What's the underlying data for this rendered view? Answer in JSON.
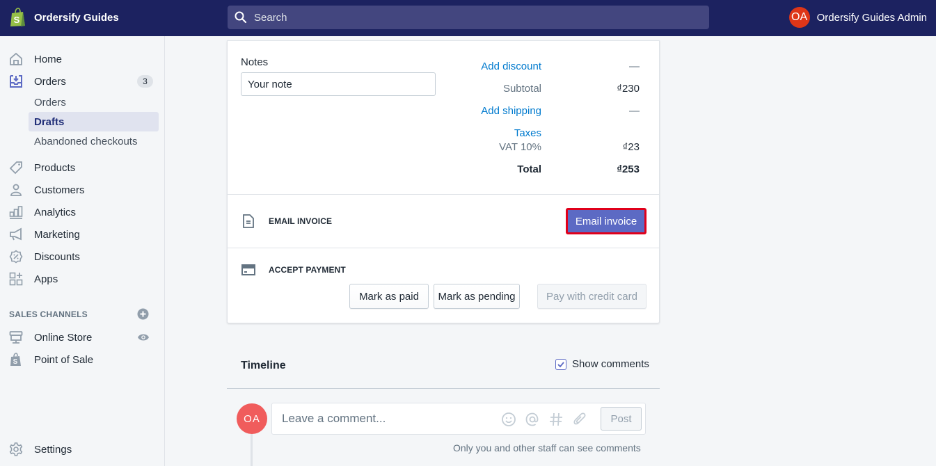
{
  "topbar": {
    "store_name": "Ordersify Guides",
    "search_placeholder": "Search",
    "account_initials": "OA",
    "account_name": "Ordersify Guides Admin"
  },
  "sidebar": {
    "items": [
      {
        "label": "Home",
        "icon": "home-icon"
      },
      {
        "label": "Orders",
        "icon": "orders-icon",
        "badge": "3"
      },
      {
        "label": "Products",
        "icon": "tag-icon"
      },
      {
        "label": "Customers",
        "icon": "person-icon"
      },
      {
        "label": "Analytics",
        "icon": "bar-chart-icon"
      },
      {
        "label": "Marketing",
        "icon": "megaphone-icon"
      },
      {
        "label": "Discounts",
        "icon": "discount-icon"
      },
      {
        "label": "Apps",
        "icon": "apps-icon"
      }
    ],
    "orders_sub": [
      {
        "label": "Orders",
        "active": false
      },
      {
        "label": "Drafts",
        "active": true
      },
      {
        "label": "Abandoned checkouts",
        "active": false
      }
    ],
    "sales_channels_title": "SALES CHANNELS",
    "channels": [
      {
        "label": "Online Store",
        "icon": "store-icon"
      },
      {
        "label": "Point of Sale",
        "icon": "pos-bag-icon"
      }
    ],
    "settings_label": "Settings"
  },
  "order": {
    "notes_label": "Notes",
    "notes_placeholder": "Your note",
    "summary": {
      "add_discount": "Add discount",
      "discount_value": "—",
      "subtotal_label": "Subtotal",
      "subtotal_value": "₫230",
      "add_shipping": "Add shipping",
      "shipping_value": "—",
      "taxes_label": "Taxes",
      "vat_label": "VAT 10%",
      "vat_value": "₫23",
      "total_label": "Total",
      "total_value": "₫253"
    },
    "email_invoice": {
      "heading": "EMAIL INVOICE",
      "button": "Email invoice"
    },
    "accept_payment": {
      "heading": "ACCEPT PAYMENT",
      "mark_paid": "Mark as paid",
      "mark_pending": "Mark as pending",
      "pay_credit_card": "Pay with credit card"
    }
  },
  "timeline": {
    "title": "Timeline",
    "show_comments_label": "Show comments",
    "show_comments_checked": true,
    "avatar_initials": "OA",
    "comment_placeholder": "Leave a comment...",
    "post_label": "Post",
    "hint": "Only you and other staff can see comments"
  },
  "colors": {
    "topbar": "#1c2260",
    "primary": "#5c6ac4",
    "link": "#007ace",
    "highlight_border": "#e0001b",
    "avatar_header": "#de3618",
    "avatar_timeline": "#f05c5c"
  }
}
